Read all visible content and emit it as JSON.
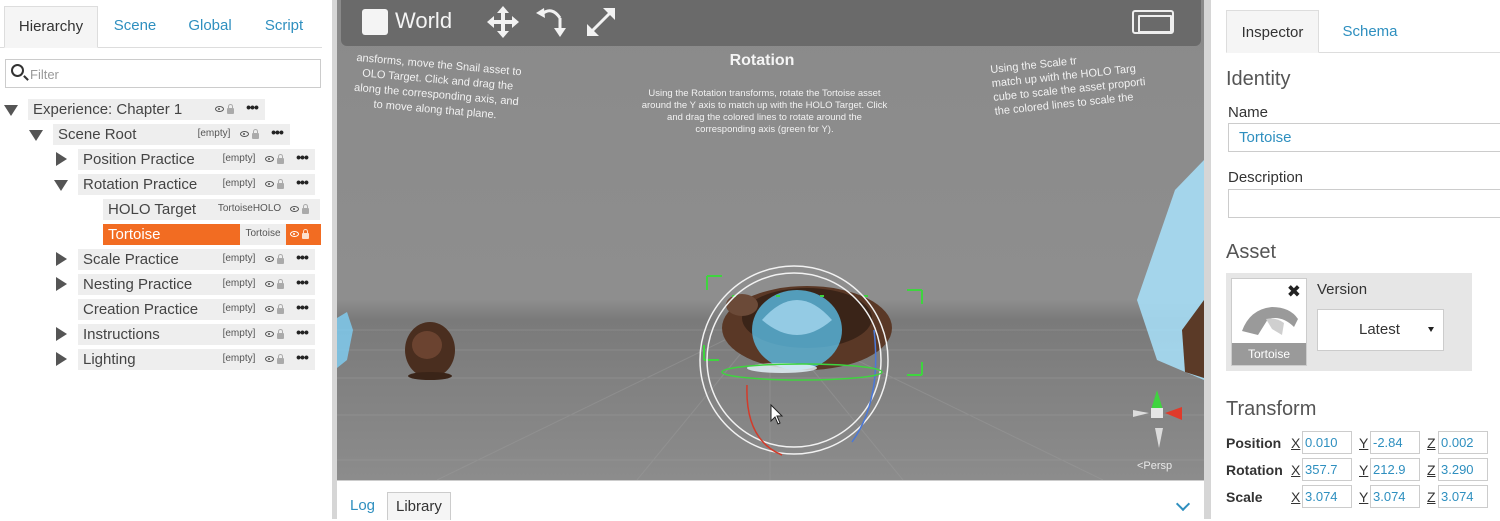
{
  "hierarchy": {
    "tabs": [
      "Hierarchy",
      "Scene",
      "Global",
      "Script"
    ],
    "filter_placeholder": "Filter",
    "rows": [
      {
        "label": "Experience: Chapter 1",
        "tag": ""
      },
      {
        "label": "Scene Root",
        "tag": "[empty]"
      },
      {
        "label": "Position Practice",
        "tag": "[empty]"
      },
      {
        "label": "Rotation Practice",
        "tag": "[empty]"
      },
      {
        "label": "HOLO Target",
        "tag": "TortoiseHOLO"
      },
      {
        "label": "Tortoise",
        "tag": "Tortoise"
      },
      {
        "label": "Scale Practice",
        "tag": "[empty]"
      },
      {
        "label": "Nesting Practice",
        "tag": "[empty]"
      },
      {
        "label": "Creation Practice",
        "tag": "[empty]"
      },
      {
        "label": "Instructions",
        "tag": "[empty]"
      },
      {
        "label": "Lighting",
        "tag": "[empty]"
      }
    ],
    "more_glyph": "•••"
  },
  "viewport": {
    "space_label": "World",
    "title": "Rotation",
    "left_instructions": [
      "ansforms, move the Snail asset to",
      "OLO Target. Click and drag the",
      "along the corresponding axis, and",
      "to move along that plane."
    ],
    "center_instructions": [
      "Using the Rotation transforms, rotate the Tortoise asset",
      "around the Y axis to match up with the HOLO Target. Click",
      "and drag the colored lines to rotate around the",
      "corresponding axis (green for Y)."
    ],
    "right_instructions": [
      "Using the Scale tr",
      "match up with the HOLO Targ",
      "cube to scale the asset proporti",
      "the colored lines to scale the"
    ],
    "persp_label": "<Persp"
  },
  "bottom_tabs": {
    "log": "Log",
    "library": "Library"
  },
  "inspector": {
    "tabs": {
      "inspector": "Inspector",
      "schema": "Schema"
    },
    "identity_heading": "Identity",
    "name_label": "Name",
    "name_value": "Tortoise",
    "description_label": "Description",
    "description_value": "",
    "asset_heading": "Asset",
    "asset_thumb_caption": "Tortoise",
    "asset_remove_glyph": "✖",
    "version_label": "Version",
    "version_value": "Latest",
    "transform_heading": "Transform",
    "transform": [
      {
        "label": "Position",
        "x": "0.010",
        "y": "-2.84",
        "z": "0.002"
      },
      {
        "label": "Rotation",
        "x": "357.7",
        "y": "212.9",
        "z": "3.290"
      },
      {
        "label": "Scale",
        "x": "3.074",
        "y": "3.074",
        "z": "3.074"
      }
    ],
    "axis_letters": [
      "X",
      "Y",
      "Z"
    ]
  },
  "colors": {
    "accent": "#2e8fbf",
    "selection": "#f26c22",
    "gizmo_green": "#3fd43f",
    "hologram": "#59c8ff"
  }
}
